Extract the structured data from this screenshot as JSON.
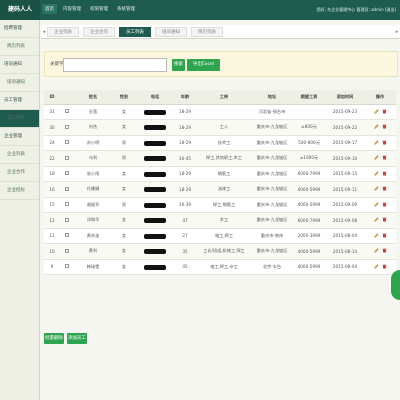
{
  "app": {
    "logo": "建码人人",
    "user_info": "您好, 东企业管理中心 管理员: admin [退出]"
  },
  "topnav": [
    {
      "label": "首页",
      "active": true
    },
    {
      "label": "内容管理",
      "active": false
    },
    {
      "label": "权限管理",
      "active": false
    },
    {
      "label": "系统管理",
      "active": false
    }
  ],
  "sidebar": [
    {
      "label": "招聘管理",
      "active": false,
      "sub": false
    },
    {
      "label": "简历列表",
      "active": false,
      "sub": true
    },
    {
      "label": "培训通知",
      "active": false,
      "sub": false
    },
    {
      "label": "培训通知",
      "active": false,
      "sub": true
    },
    {
      "label": "员工管理",
      "active": false,
      "sub": false
    },
    {
      "label": "员工列表",
      "active": true,
      "sub": true
    },
    {
      "label": "企业管理",
      "active": false,
      "sub": false
    },
    {
      "label": "企业列表",
      "active": false,
      "sub": true
    },
    {
      "label": "企业合作",
      "active": false,
      "sub": true
    },
    {
      "label": "企业招标",
      "active": false,
      "sub": true
    }
  ],
  "tabs": [
    {
      "label": "企业列表",
      "active": false
    },
    {
      "label": "企业合作",
      "active": false
    },
    {
      "label": "员工列表",
      "active": true
    },
    {
      "label": "培训通知",
      "active": false
    },
    {
      "label": "简历列表",
      "active": false
    }
  ],
  "search": {
    "label": "关键字:",
    "placeholder": "",
    "search_btn": "搜索",
    "export_btn": "导出Excel"
  },
  "table": {
    "headers": [
      "ID",
      "",
      "姓名",
      "性别",
      "电话",
      "年龄",
      "工种",
      "地址",
      "期望工资",
      "添加时间",
      "操作"
    ],
    "rows": [
      {
        "id": "31",
        "name": "长宽",
        "gender": "女",
        "age": "18-29",
        "job": "",
        "address": "河北省-邢台市",
        "salary": "",
        "date": "2015-09-23"
      },
      {
        "id": "30",
        "name": "刘杰",
        "gender": "女",
        "age": "18-29",
        "job": "工人",
        "address": "重庆市-九龙坡区",
        "salary": "≥800元",
        "date": "2015-09-22"
      },
      {
        "id": "24",
        "name": "苏小明",
        "gender": "男",
        "age": "18-29",
        "job": "技术工",
        "address": "重庆市-九龙坡区",
        "salary": "500-800元",
        "date": "2015-09-17"
      },
      {
        "id": "22",
        "name": "乌利",
        "gender": "男",
        "age": "30-45",
        "job": "焊工,其他职工,木工",
        "address": "重庆市-九龙坡区",
        "salary": "≥1000元",
        "date": "2015-09-16"
      },
      {
        "id": "18",
        "name": "张小雨",
        "gender": "女",
        "age": "18-29",
        "job": "钢筋工",
        "address": "重庆市-九龙坡区",
        "salary": "6000-7999",
        "date": "2015-09-15"
      },
      {
        "id": "16",
        "name": "任姗姗",
        "gender": "女",
        "age": "18-29",
        "job": "油漆工",
        "address": "重庆市-九龙坡区",
        "salary": "4000-5999",
        "date": "2015-09-11"
      },
      {
        "id": "15",
        "name": "谢福军",
        "gender": "男",
        "age": "30-39",
        "job": "焊工,钢筋工",
        "address": "重庆市-九龙坡区",
        "salary": "4000-5999",
        "date": "2015-09-09"
      },
      {
        "id": "12",
        "name": "邓和华",
        "gender": "女",
        "age": "47",
        "job": "木工",
        "address": "重庆市-九龙坡区",
        "salary": "6000-7999",
        "date": "2015-09-08"
      },
      {
        "id": "11",
        "name": "黄东波",
        "gender": "女",
        "age": "27",
        "job": "电工,焊工",
        "address": "重庆市-南岸",
        "salary": "2000-3999",
        "date": "2015-08-04"
      },
      {
        "id": "10",
        "name": "黄利",
        "gender": "女",
        "age": "35",
        "job": "工长/班组,机械工,焊工",
        "address": "重庆市-九龙坡区",
        "salary": "4000-5999",
        "date": "2015-08-14"
      },
      {
        "id": "9",
        "name": "韩瑞雪",
        "gender": "女",
        "age": "45",
        "job": "电工,焊工,杂工",
        "address": "北京-丰台",
        "salary": "4000-5999",
        "date": "2015-08-04"
      }
    ]
  },
  "bottom": {
    "delete_btn": "批量删除",
    "add_btn": "添加员工"
  },
  "colors": {
    "primary": "#1e5c4f",
    "accent_green": "#2ea44f",
    "search_bg": "#fbf7df"
  }
}
